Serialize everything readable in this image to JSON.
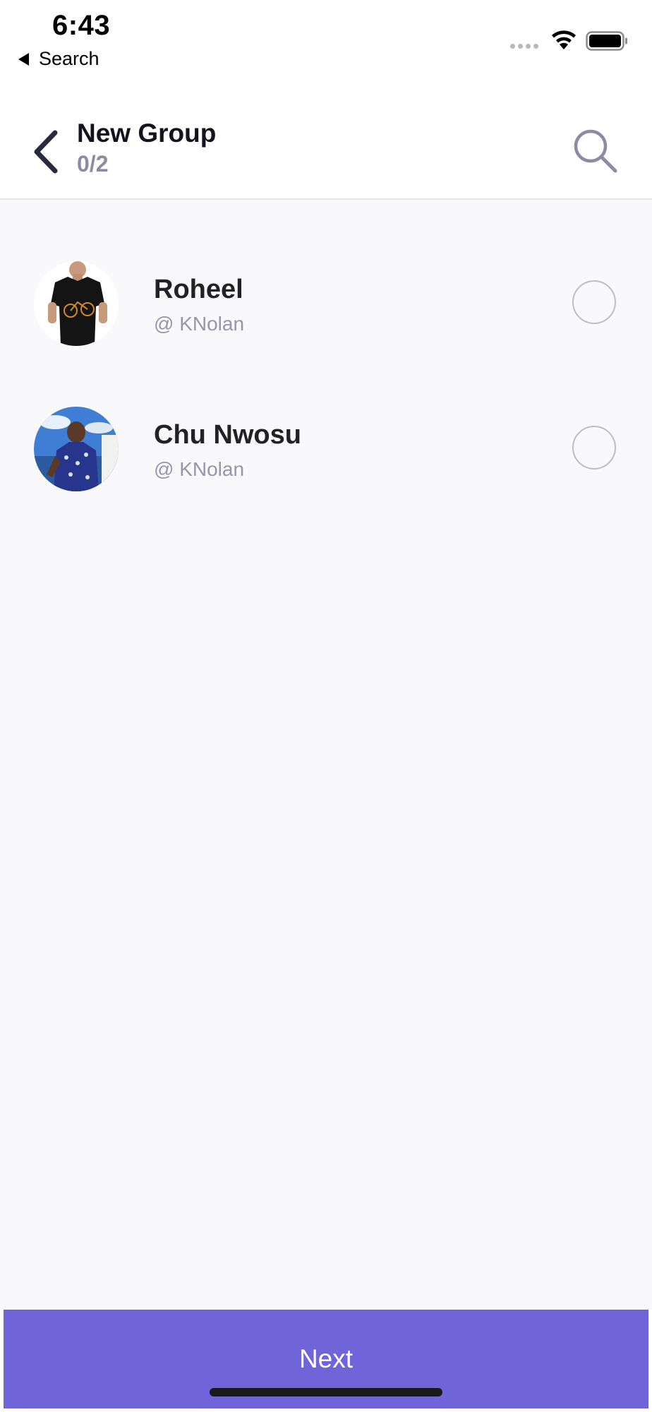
{
  "status_bar": {
    "time": "6:43",
    "back_label": "Search"
  },
  "header": {
    "title": "New Group",
    "subtitle": "0/2"
  },
  "contacts": [
    {
      "name": "Roheel",
      "handle": "@ KNolan"
    },
    {
      "name": "Chu Nwosu",
      "handle": "@ KNolan"
    }
  ],
  "footer": {
    "next_label": "Next"
  },
  "colors": {
    "accent": "#7064d9",
    "title": "#14121f",
    "subtitle": "#8e8aa4",
    "list_background": "#f9f9fb"
  },
  "icons": {
    "back": "chevron-left-icon",
    "search": "search-icon",
    "wifi": "wifi-icon",
    "battery": "battery-icon"
  }
}
